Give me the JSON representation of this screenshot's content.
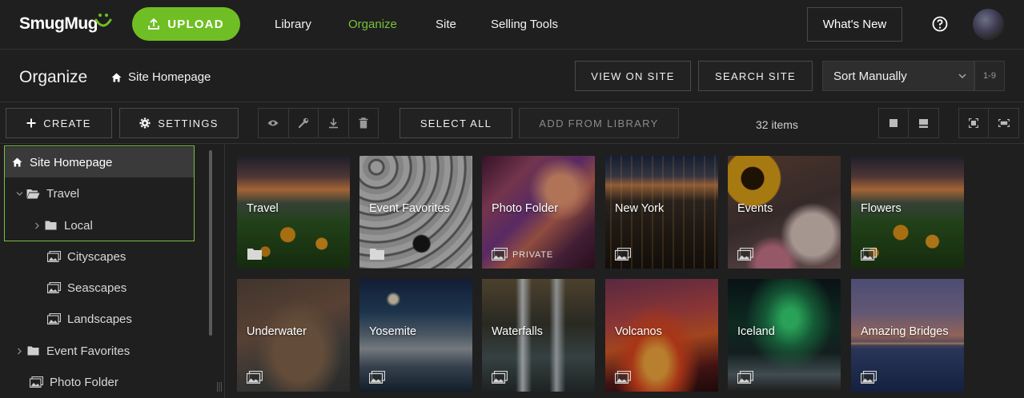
{
  "brand": {
    "name": "SmugMug",
    "upload_label": "UPLOAD"
  },
  "nav": {
    "items": [
      {
        "label": "Library",
        "active": false
      },
      {
        "label": "Organize",
        "active": true
      },
      {
        "label": "Site",
        "active": false
      },
      {
        "label": "Selling Tools",
        "active": false
      }
    ],
    "whats_new_label": "What's New"
  },
  "header": {
    "title": "Organize",
    "breadcrumb": "Site Homepage",
    "view_on_site_label": "VIEW ON SITE",
    "search_site_label": "SEARCH SITE",
    "sort_value": "Sort Manually",
    "sort_range": "1-9"
  },
  "toolbar": {
    "create_label": "CREATE",
    "settings_label": "SETTINGS",
    "select_all_label": "SELECT ALL",
    "add_from_library_label": "ADD FROM LIBRARY",
    "items_count": "32 items"
  },
  "tree": [
    {
      "label": "Site Homepage",
      "icon": "home-icon",
      "expander": "none"
    },
    {
      "label": "Travel",
      "icon": "folder-open-icon",
      "expander": "expanded"
    },
    {
      "label": "Local",
      "icon": "folder-icon",
      "expander": "collapsed"
    },
    {
      "label": "Cityscapes",
      "icon": "gallery-icon",
      "expander": "none"
    },
    {
      "label": "Seascapes",
      "icon": "gallery-icon",
      "expander": "none"
    },
    {
      "label": "Landscapes",
      "icon": "gallery-icon",
      "expander": "none"
    },
    {
      "label": "Event Favorites",
      "icon": "folder-icon",
      "expander": "collapsed"
    },
    {
      "label": "Photo Folder",
      "icon": "gallery-icon",
      "expander": "none"
    }
  ],
  "tiles": [
    {
      "title": "Travel",
      "kind": "folder-icon",
      "badge": ""
    },
    {
      "title": "Event Favorites",
      "kind": "folder-icon",
      "badge": ""
    },
    {
      "title": "Photo Folder",
      "kind": "gallery-icon",
      "badge": "PRIVATE"
    },
    {
      "title": "New York",
      "kind": "gallery-icon",
      "badge": ""
    },
    {
      "title": "Events",
      "kind": "gallery-icon",
      "badge": ""
    },
    {
      "title": "Flowers",
      "kind": "gallery-icon",
      "badge": ""
    },
    {
      "title": "Underwater",
      "kind": "gallery-icon",
      "badge": ""
    },
    {
      "title": "Yosemite",
      "kind": "gallery-icon",
      "badge": ""
    },
    {
      "title": "Waterfalls",
      "kind": "gallery-icon",
      "badge": ""
    },
    {
      "title": "Volcanos",
      "kind": "gallery-icon",
      "badge": ""
    },
    {
      "title": "Iceland",
      "kind": "gallery-icon",
      "badge": ""
    },
    {
      "title": "Amazing Bridges",
      "kind": "gallery-icon",
      "badge": ""
    }
  ],
  "colors": {
    "accent": "#6fbf24",
    "nav_active": "#77c23a",
    "background": "#1f1f1f"
  }
}
